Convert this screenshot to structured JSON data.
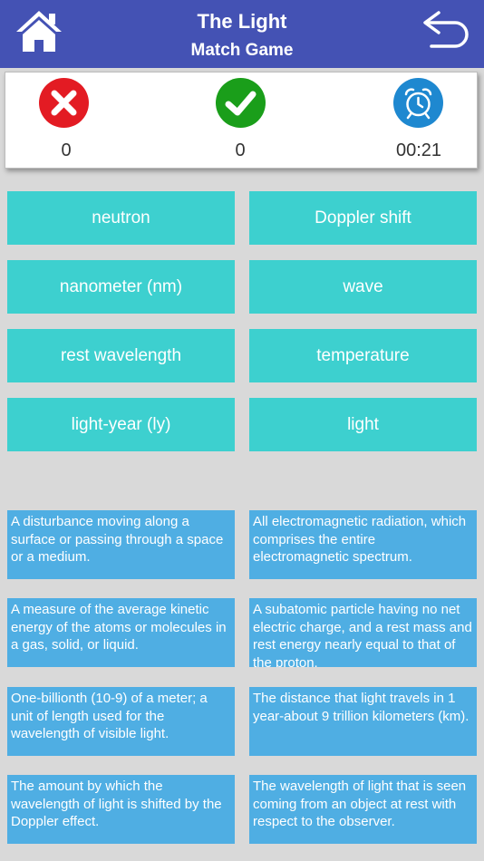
{
  "header": {
    "title": "The Light",
    "subtitle": "Match Game",
    "home_icon": "home-icon",
    "back_icon": "back-arrow-icon",
    "background": "#4452b4"
  },
  "scores": {
    "wrong": {
      "icon": "x-icon",
      "value": "0",
      "color": "#e31b23"
    },
    "correct": {
      "icon": "check-icon",
      "value": "0",
      "color": "#1a9e1a"
    },
    "timer": {
      "icon": "alarm-clock-icon",
      "value": "00:21",
      "color": "#1e88d0"
    }
  },
  "terms": [
    "neutron",
    "Doppler shift",
    "nanometer (nm)",
    "wave",
    "rest wavelength",
    "temperature",
    "light-year (ly)",
    "light"
  ],
  "definitions": [
    "A disturbance moving along a surface or passing through a space or a medium.",
    "All electromagnetic radiation, which comprises the entire electromagnetic spectrum.",
    "A measure of the average kinetic energy of the atoms or molecules in a gas, solid, or liquid.",
    "A subatomic particle having no net electric charge, and a rest mass and rest energy nearly equal to that of the proton.",
    "One-billionth (10-9) of a meter; a unit of length used for the wavelength of visible light.",
    "The distance that light travels in 1 year-about 9 trillion kilometers (km).",
    "The amount by which the wavelength of light is shifted by the Doppler effect.",
    "The wavelength of light that is seen coming from an object at rest with respect to the observer."
  ],
  "colors": {
    "term_tile": "#3dd0cf",
    "definition_tile": "#4faee3",
    "background": "#d9d9d9"
  }
}
